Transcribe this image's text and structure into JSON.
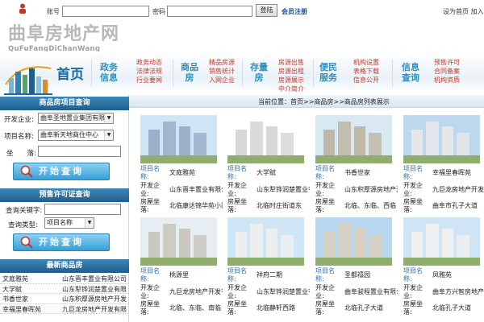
{
  "topbar": {
    "account_label": "账号",
    "password_label": "密码",
    "login_label": "登陆",
    "register_label": "会员注册",
    "right_links": "设为首页 加入收藏"
  },
  "logo": {
    "cn": "曲阜房地产网",
    "en": "QuFuFangDiChanWang"
  },
  "nav": {
    "home": "首页",
    "groups": [
      {
        "cat": "政务信息",
        "subs": [
          "政务动态",
          "法律法规",
          "行业要闻"
        ]
      },
      {
        "cat": "商品房",
        "subs": [
          "精品房源",
          "销售统计",
          "入网企业"
        ]
      },
      {
        "cat": "存量房",
        "subs": [
          "房源出售",
          "房源出租",
          "房源展示",
          "中介简介"
        ]
      },
      {
        "cat": "便民服务",
        "subs": [
          "机构设置",
          "表格下载",
          "信息公开"
        ]
      },
      {
        "cat": "信息查询",
        "subs": [
          "预售许可",
          "合同备案",
          "机构资质"
        ]
      }
    ]
  },
  "sidebar": {
    "query_title": "商品房项目查询",
    "developer_label": "开发企业:",
    "developer_value": "曲阜圣地置业集团有限公司",
    "project_label": "项目名称:",
    "project_value": "曲阜新天地商住中心",
    "location_label": "坐　　落:",
    "search_label": "开始查询",
    "permit_title": "预售许可证查询",
    "keyword_label": "查询关键字:",
    "type_label": "查询类型:",
    "type_value": "项目名称",
    "search2_label": "开始查询",
    "new_title": "最新商品房",
    "new_items": [
      {
        "name": "文庭雅苑",
        "company": "山东晋丰置业有限公司"
      },
      {
        "name": "大学赋",
        "company": "山东犁铧润楚置业有限"
      },
      {
        "name": "书香世家",
        "company": "山东积厚源房地产开发"
      },
      {
        "name": "幸福里春晖苑",
        "company": "九巨龙房地产开发有限"
      }
    ]
  },
  "breadcrumb": "当前位置：首页>>商品房>>商品房列表展示",
  "labels": {
    "project_name": "项目名称:",
    "developer": "开发企业:",
    "location": "房屋坐落:"
  },
  "projects": [
    {
      "name": "文庭雅苑",
      "developer": "山东晋丰置业有限公司",
      "location": "北临康达锦华苑小区"
    },
    {
      "name": "大学赋",
      "developer": "山东犁铧润楚置业有限公司",
      "location": "北临时庄街道东"
    },
    {
      "name": "书香世家",
      "developer": "山东积厚源房地产开发有限",
      "location": "北临、东临、西临"
    },
    {
      "name": "幸福里春晖苑",
      "developer": "九巨龙房地产开发有限公司",
      "location": "曲阜市孔子大道"
    },
    {
      "name": "桃源里",
      "developer": "九巨龙房地产开发有限公司",
      "location": "北临、东临、南临"
    },
    {
      "name": "祥府二期",
      "developer": "山东犁铧润楚置业有限公司",
      "location": "北临静轩西路"
    },
    {
      "name": "圣都禧园",
      "developer": "曲阜骏程置业有限公司",
      "location": "北临孔子大道"
    },
    {
      "name": "凤雅苑",
      "developer": "曲阜方兴智房地产开发",
      "location": "北临孔子大道"
    }
  ]
}
